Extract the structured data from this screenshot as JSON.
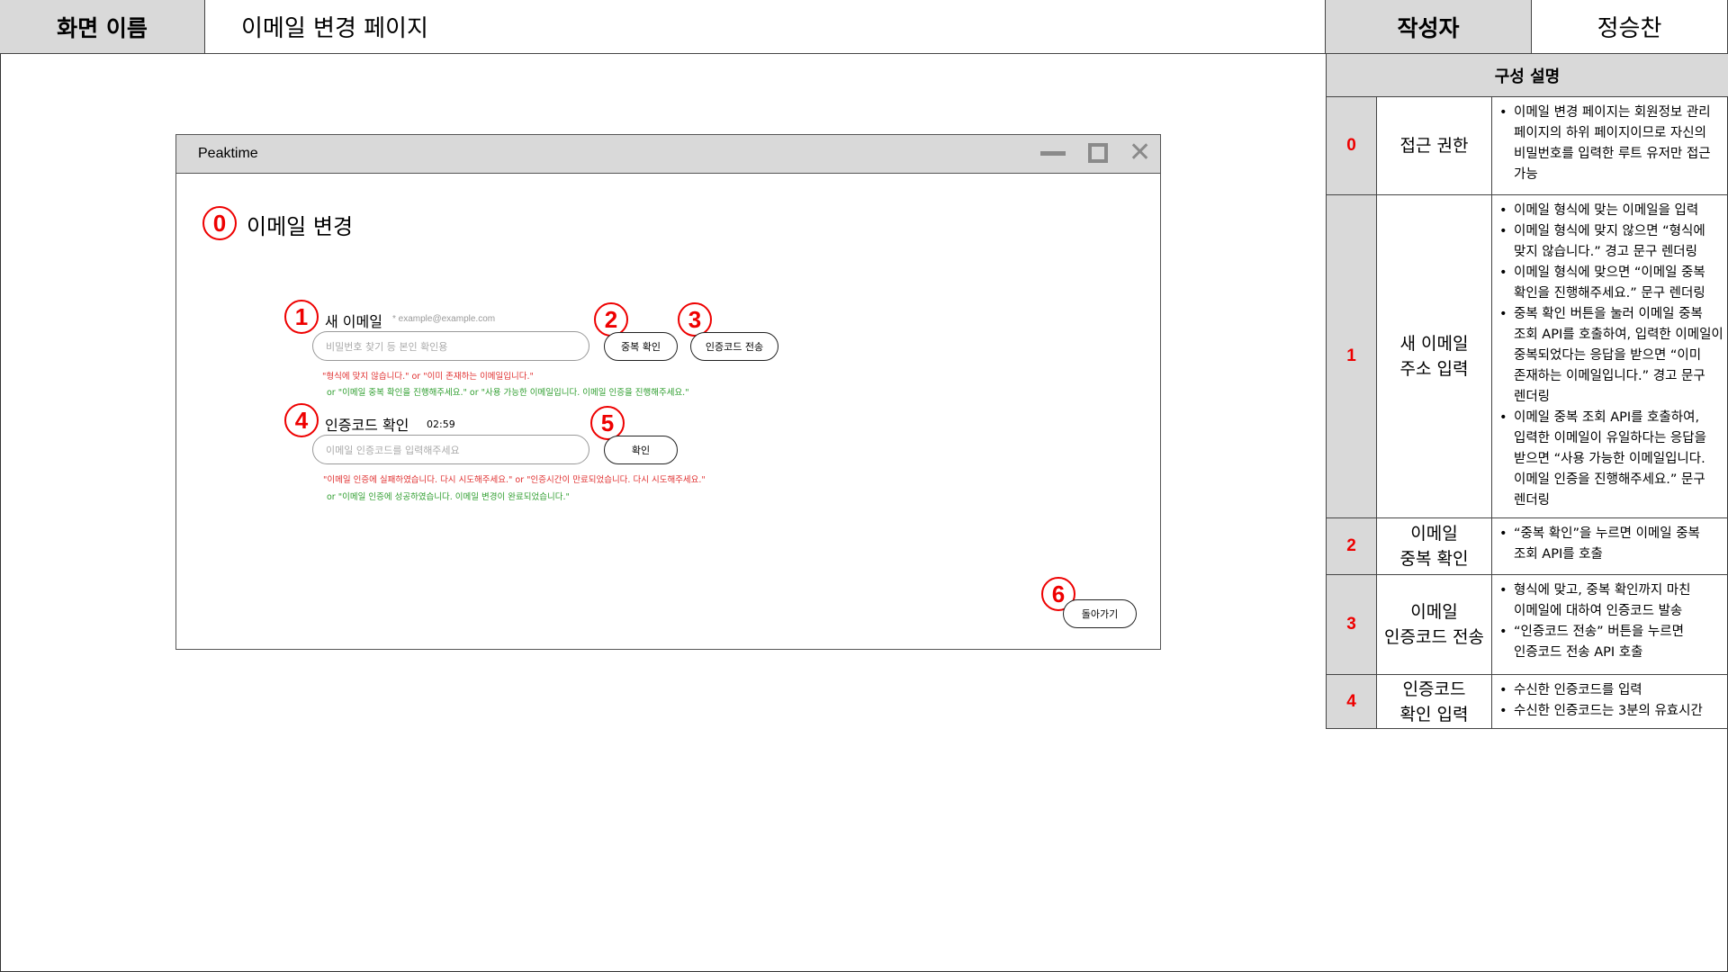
{
  "header": {
    "screen_name_label": "화면 이름",
    "screen_name_value": "이메일 변경 페이지",
    "author_label": "작성자",
    "author_value": "정승찬"
  },
  "window": {
    "title": "Peaktime"
  },
  "page": {
    "title": "이메일 변경",
    "markers": [
      "0",
      "1",
      "2",
      "3",
      "4",
      "5",
      "6"
    ],
    "new_email": {
      "label": "새 이메일",
      "hint": "* example@example.com",
      "placeholder": "비밀번호 찾기 등 본인 확인용",
      "dup_check_button": "중복 확인",
      "send_code_button": "인증코드 전송",
      "error_message": "\"형식에 맞지 않습니다.\" or \"이미 존재하는 이메일입니다.\"",
      "success_message": "or \"이메일 중복 확인을 진행해주세요.\" or \"사용 가능한 이메일입니다. 이메일 인증을 진행해주세요.\""
    },
    "code_check": {
      "label": "인증코드 확인",
      "timer": "02:59",
      "placeholder": "이메일 인증코드를 입력해주세요",
      "confirm_button": "확인",
      "error_message": "\"이메일 인증에 실패하였습니다. 다시 시도해주세요.\" or \"인증시간이 만료되었습니다. 다시 시도해주세요.\"",
      "success_message": "or \"이메일 인증에 성공하였습니다. 이메일 변경이 완료되었습니다.\""
    },
    "back_button": "돌아가기"
  },
  "description": {
    "title": "구성 설명",
    "rows": [
      {
        "num": "0",
        "name": "접근 권한",
        "items": [
          "이메일 변경 페이지는 회원정보 관리 페이지의 하위 페이지이므로 자신의 비밀번호를 입력한 루트 유저만 접근 가능"
        ]
      },
      {
        "num": "1",
        "name": "새 이메일\n주소 입력",
        "items": [
          "이메일 형식에 맞는 이메일을 입력",
          "이메일 형식에 맞지 않으면 “형식에 맞지 않습니다.” 경고 문구 렌더링",
          "이메일 형식에 맞으면 “이메일 중복 확인을 진행해주세요.” 문구 렌더링",
          "중복 확인 버튼을 눌러 이메일 중복 조회 API를 호출하여, 입력한 이메일이 중복되었다는 응답을 받으면 “이미 존재하는 이메일입니다.” 경고 문구 렌더링",
          "이메일 중복 조회 API를 호출하여, 입력한 이메일이 유일하다는 응답을 받으면 “사용 가능한 이메일입니다. 이메일 인증을 진행해주세요.” 문구 렌더링"
        ]
      },
      {
        "num": "2",
        "name": "이메일\n중복 확인",
        "items": [
          "“중복 확인”을 누르면 이메일 중복 조회 API를 호출"
        ]
      },
      {
        "num": "3",
        "name": "이메일\n인증코드 전송",
        "items": [
          "형식에 맞고, 중복 확인까지 마친 이메일에 대하여 인증코드 발송",
          "“인증코드 전송” 버튼을 누르면 인증코드 전송 API 호출"
        ]
      },
      {
        "num": "4",
        "name": "인증코드\n확인 입력",
        "items": [
          "수신한 인증코드를 입력",
          "수신한 인증코드는 3분의 유효시간"
        ]
      }
    ]
  }
}
